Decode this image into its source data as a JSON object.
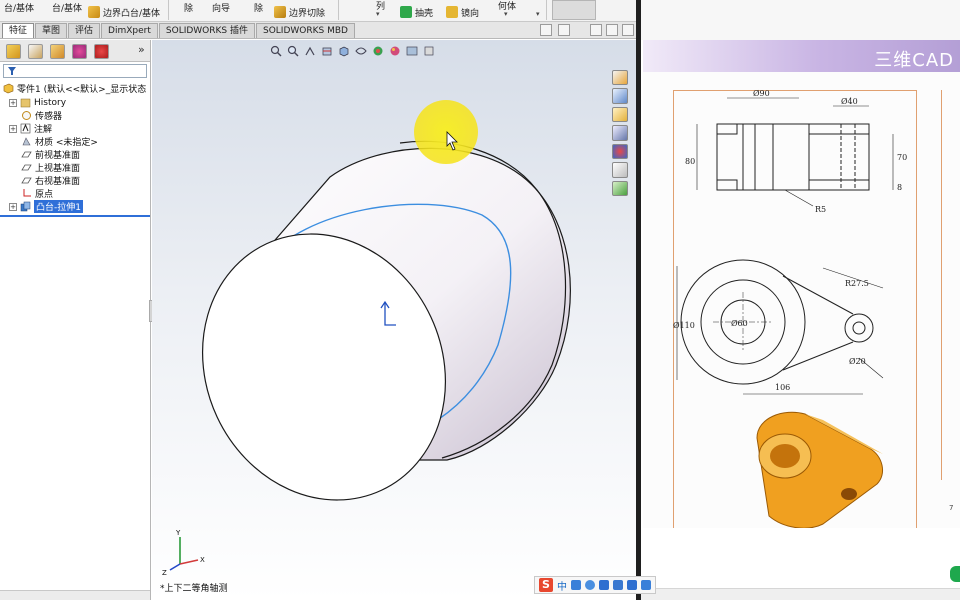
{
  "toolbar": {
    "items": [
      {
        "label": "台/基体",
        "name": "boss-base-cut-label"
      },
      {
        "label": "台/基体",
        "name": "boss-base-label"
      },
      {
        "label": "边界凸台/基体",
        "name": "boundary-boss-button"
      },
      {
        "label": "除",
        "name": "remove-label"
      },
      {
        "label": "向导",
        "name": "wizard-label"
      },
      {
        "label": "除",
        "name": "remove-label-2"
      },
      {
        "label": "边界切除",
        "name": "boundary-cut-button"
      },
      {
        "label": "抽壳",
        "name": "shell-button"
      },
      {
        "label": "镜向",
        "name": "mirror-button"
      },
      {
        "label": "列",
        "name": "pattern-label"
      },
      {
        "label": "何体",
        "name": "geometry-label"
      }
    ]
  },
  "command_tabs": [
    "特征",
    "草图",
    "评估",
    "DimXpert",
    "SOLIDWORKS 插件",
    "SOLIDWORKS MBD"
  ],
  "active_tab": "特征",
  "feature_tree": {
    "root": "零件1  (默认<<默认>_显示状态",
    "items": [
      {
        "label": "History",
        "expand": "+"
      },
      {
        "label": "传感器",
        "expand": ""
      },
      {
        "label": "注解",
        "expand": "+"
      },
      {
        "label": "材质 <未指定>",
        "expand": ""
      },
      {
        "label": "前视基准面",
        "expand": ""
      },
      {
        "label": "上视基准面",
        "expand": ""
      },
      {
        "label": "右视基准面",
        "expand": ""
      },
      {
        "label": "原点",
        "expand": ""
      },
      {
        "label": "凸台-拉伸1",
        "expand": "+",
        "selected": true
      }
    ]
  },
  "viewport": {
    "view_label": "*上下二等角轴测",
    "triad": {
      "x": "X",
      "y": "Y",
      "z": "Z"
    }
  },
  "reference_page": {
    "banner": "三维CAD",
    "drawing_top": {
      "dim_width": "Ø90",
      "dim_boss": "Ø40",
      "dim_height_left": "80",
      "dim_height_right": "70",
      "dim_small": "8",
      "fillet": "R5"
    },
    "drawing_mid": {
      "dim_outer": "Ø110",
      "dim_inner": "Ø60",
      "dim_arc": "R27.5",
      "dim_hole": "Ø20",
      "dim_length": "106"
    },
    "page_number": "7"
  },
  "ime": {
    "logo": "S",
    "lang": "中"
  },
  "colors": {
    "selection": "#2f6fd8",
    "cylinder_edge": "#1a1a1a",
    "silhouette_highlight": "#3c8ee0",
    "cursor_halo": "#f2e600",
    "part_orange": "#f0a020"
  }
}
